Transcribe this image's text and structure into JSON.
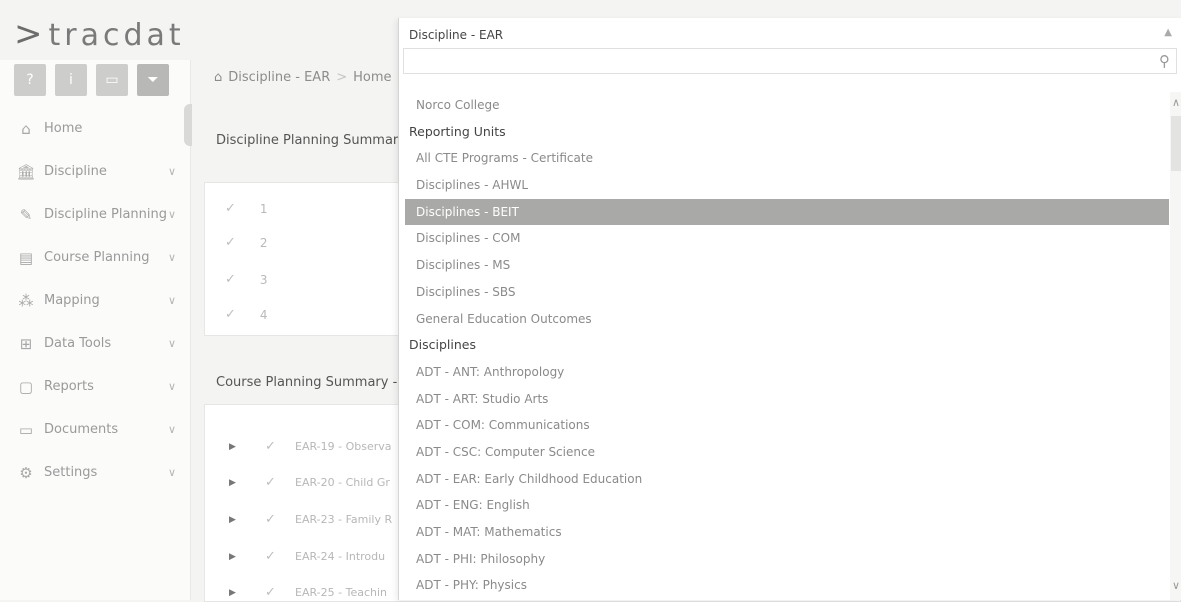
{
  "app": {
    "logo_text": "tracdat",
    "logo_chevron": ">"
  },
  "toolbar": [
    {
      "name": "help-button",
      "glyph": "?"
    },
    {
      "name": "info-button",
      "glyph": "i"
    },
    {
      "name": "window-button",
      "glyph": "▭"
    },
    {
      "name": "filter-button",
      "glyph": "⏷"
    }
  ],
  "sidebar": {
    "items": [
      {
        "label": "Home",
        "icon": "home-icon",
        "has_chevron": false
      },
      {
        "label": "Discipline",
        "icon": "institution-icon",
        "has_chevron": true
      },
      {
        "label": "Discipline Planning",
        "icon": "pencil-icon",
        "has_chevron": true
      },
      {
        "label": "Course Planning",
        "icon": "book-icon",
        "has_chevron": true
      },
      {
        "label": "Mapping",
        "icon": "sitemap-icon",
        "has_chevron": true
      },
      {
        "label": "Data Tools",
        "icon": "table-icon",
        "has_chevron": true
      },
      {
        "label": "Reports",
        "icon": "report-icon",
        "has_chevron": true
      },
      {
        "label": "Documents",
        "icon": "folder-icon",
        "has_chevron": true
      },
      {
        "label": "Settings",
        "icon": "gear-icon",
        "has_chevron": true
      }
    ]
  },
  "breadcrumb": {
    "first": "Discipline - EAR",
    "separator": ">",
    "second": "Home"
  },
  "main": {
    "plan_title": "Discipline Planning Summary",
    "plan_rows": [
      "1",
      "2",
      "3",
      "4"
    ],
    "course_title": "Course Planning Summary - C",
    "course_rows": [
      "EAR-19 - Observa",
      "EAR-20 - Child Gr",
      "EAR-23 - Family R",
      "EAR-24 - Introdu",
      "EAR-25 - Teachin"
    ]
  },
  "dropdown": {
    "selected_value": "Discipline - EAR",
    "search_placeholder": "",
    "items": [
      {
        "label": "Norco College",
        "type": "option"
      },
      {
        "label": "Reporting Units",
        "type": "group"
      },
      {
        "label": "All CTE Programs - Certificate",
        "type": "option"
      },
      {
        "label": "Disciplines - AHWL",
        "type": "option"
      },
      {
        "label": "Disciplines - BEIT",
        "type": "option",
        "selected": true
      },
      {
        "label": "Disciplines - COM",
        "type": "option"
      },
      {
        "label": "Disciplines - MS",
        "type": "option"
      },
      {
        "label": "Disciplines - SBS",
        "type": "option"
      },
      {
        "label": "General Education Outcomes",
        "type": "option"
      },
      {
        "label": "Disciplines",
        "type": "group"
      },
      {
        "label": "ADT - ANT: Anthropology",
        "type": "option"
      },
      {
        "label": "ADT - ART: Studio Arts",
        "type": "option"
      },
      {
        "label": "ADT - COM: Communications",
        "type": "option"
      },
      {
        "label": "ADT - CSC: Computer Science",
        "type": "option"
      },
      {
        "label": "ADT - EAR: Early Childhood Education",
        "type": "option"
      },
      {
        "label": "ADT - ENG: English",
        "type": "option"
      },
      {
        "label": "ADT - MAT: Mathematics",
        "type": "option"
      },
      {
        "label": "ADT - PHI: Philosophy",
        "type": "option"
      },
      {
        "label": "ADT - PHY: Physics",
        "type": "option"
      }
    ]
  },
  "colors": {
    "selected_bg": "#a9a9a7",
    "sidebar_text": "#9a9a9a",
    "group_text": "#444444"
  }
}
